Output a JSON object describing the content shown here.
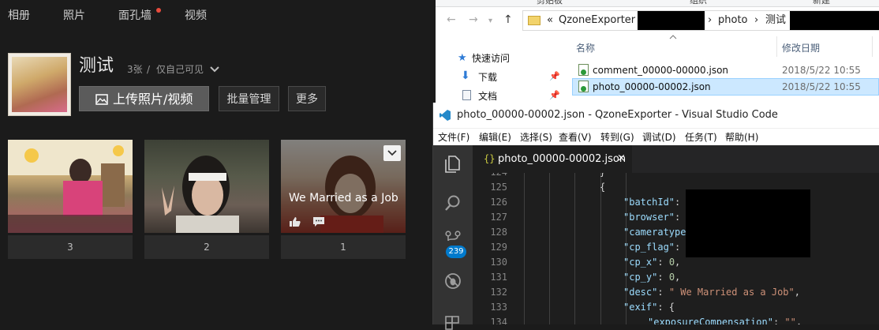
{
  "qzone": {
    "nav": [
      "相册",
      "照片",
      "面孔墙",
      "视频"
    ],
    "album": {
      "title": "测试",
      "count": "3张",
      "visibility": "仅自己可见",
      "upload_label": "上传照片/视频",
      "batch_label": "批量管理",
      "more_label": "更多"
    },
    "thumbs": [
      {
        "num": "3"
      },
      {
        "num": "2"
      },
      {
        "num": "1",
        "caption": "We Married as a Job"
      }
    ]
  },
  "explorer": {
    "ribbon": [
      "剪贴板",
      "组织",
      "新建"
    ],
    "breadcrumb": [
      "«",
      "QzoneExporter",
      "›",
      "›",
      "photo",
      "›",
      "测试"
    ],
    "columns": {
      "name": "名称",
      "date": "修改日期"
    },
    "sidebar": [
      "快速访问",
      "下载",
      "文档"
    ],
    "files": [
      {
        "name": "comment_00000-00000.json",
        "date": "2018/5/22 10:55"
      },
      {
        "name": "photo_00000-00002.json",
        "date": "2018/5/22 10:55"
      }
    ]
  },
  "vscode": {
    "title": "photo_00000-00002.json - QzoneExporter - Visual Studio Code",
    "menu": [
      "文件(F)",
      "编辑(E)",
      "选择(S)",
      "查看(V)",
      "转到(G)",
      "调试(D)",
      "任务(T)",
      "帮助(H)"
    ],
    "tab": {
      "icon": "{}",
      "name": "photo_00000-00002.json",
      "close": "×"
    },
    "scm_badge": "239",
    "lines": [
      {
        "n": "124",
        "text": "}"
      },
      {
        "n": "125",
        "text": "{"
      },
      {
        "n": "126",
        "key": "\"batchId\"",
        "rest": ":"
      },
      {
        "n": "127",
        "key": "\"browser\"",
        "rest": ":"
      },
      {
        "n": "128",
        "key": "\"cameratype"
      },
      {
        "n": "129",
        "key": "\"cp_flag\"",
        "rest": ":"
      },
      {
        "n": "130",
        "key": "\"cp_x\"",
        "rest": ": ",
        "num": "0",
        "tail": ","
      },
      {
        "n": "131",
        "key": "\"cp_y\"",
        "rest": ": ",
        "num": "0",
        "tail": ","
      },
      {
        "n": "132",
        "key": "\"desc\"",
        "rest": ": ",
        "str": "\" We Married as a Job\"",
        "tail": ","
      },
      {
        "n": "133",
        "key": "\"exif\"",
        "rest": ": {"
      },
      {
        "n": "134",
        "key": "\"exposureCompensation\"",
        "rest": ": ",
        "str": "\"\"",
        "tail": ","
      }
    ]
  },
  "colors": {
    "accent": "#007acc",
    "selection": "#cce8ff",
    "notify_dot": "#e84c3d"
  }
}
